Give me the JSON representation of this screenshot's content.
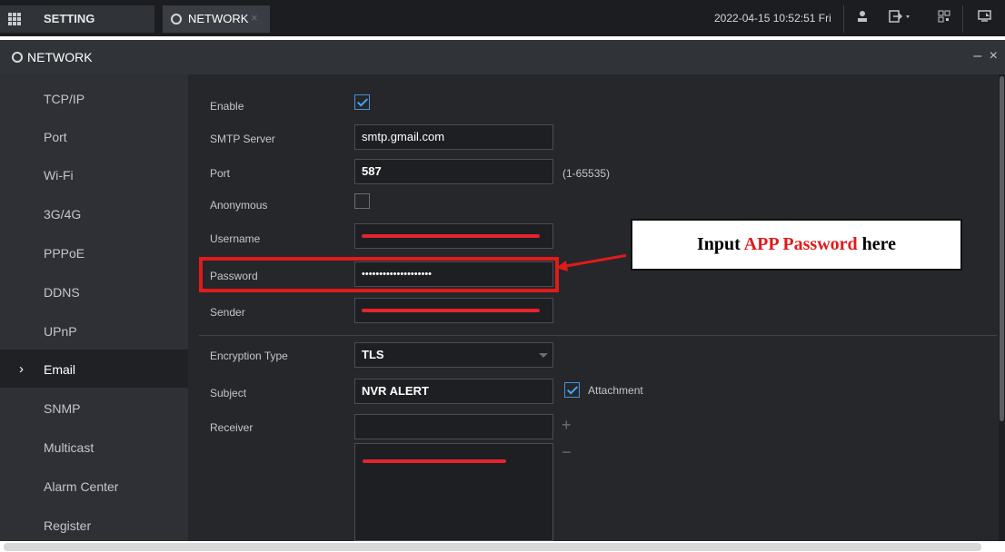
{
  "topbar": {
    "menu_label": "SETTING",
    "tab_label": "NETWORK",
    "tab_close": "×",
    "datetime": "2022-04-15 10:52:51 Fri"
  },
  "panel": {
    "title": "NETWORK",
    "controls": "– ×"
  },
  "sidebar": {
    "active_chevron": "›",
    "items": [
      {
        "label": "TCP/IP"
      },
      {
        "label": "Port"
      },
      {
        "label": "Wi-Fi"
      },
      {
        "label": "3G/4G"
      },
      {
        "label": "PPPoE"
      },
      {
        "label": "DDNS"
      },
      {
        "label": "UPnP"
      },
      {
        "label": "Email"
      },
      {
        "label": "SNMP"
      },
      {
        "label": "Multicast"
      },
      {
        "label": "Alarm Center"
      },
      {
        "label": "Register"
      }
    ],
    "active_index": 7
  },
  "form": {
    "enable_label": "Enable",
    "enable_checked": true,
    "smtp_label": "SMTP Server",
    "smtp_value": "smtp.gmail.com",
    "port_label": "Port",
    "port_value": "587",
    "port_hint": "(1-65535)",
    "anonymous_label": "Anonymous",
    "anonymous_checked": false,
    "username_label": "Username",
    "password_label": "Password",
    "password_value": "••••••••••••••••••••",
    "sender_label": "Sender",
    "encryption_label": "Encryption Type",
    "encryption_value": "TLS",
    "subject_label": "Subject",
    "subject_value": "NVR ALERT",
    "attachment_label": "Attachment",
    "attachment_checked": true,
    "receiver_label": "Receiver",
    "receiver_value": "",
    "add_symbol": "+",
    "remove_symbol": "−"
  },
  "annotation": {
    "prefix": "Input ",
    "highlight": "APP Password",
    "suffix": " here",
    "color": "#e01b1b"
  },
  "icons": [
    "grid-menu-icon",
    "globe-icon",
    "user-icon",
    "logout-icon",
    "qr-code-icon",
    "monitor-icon"
  ]
}
